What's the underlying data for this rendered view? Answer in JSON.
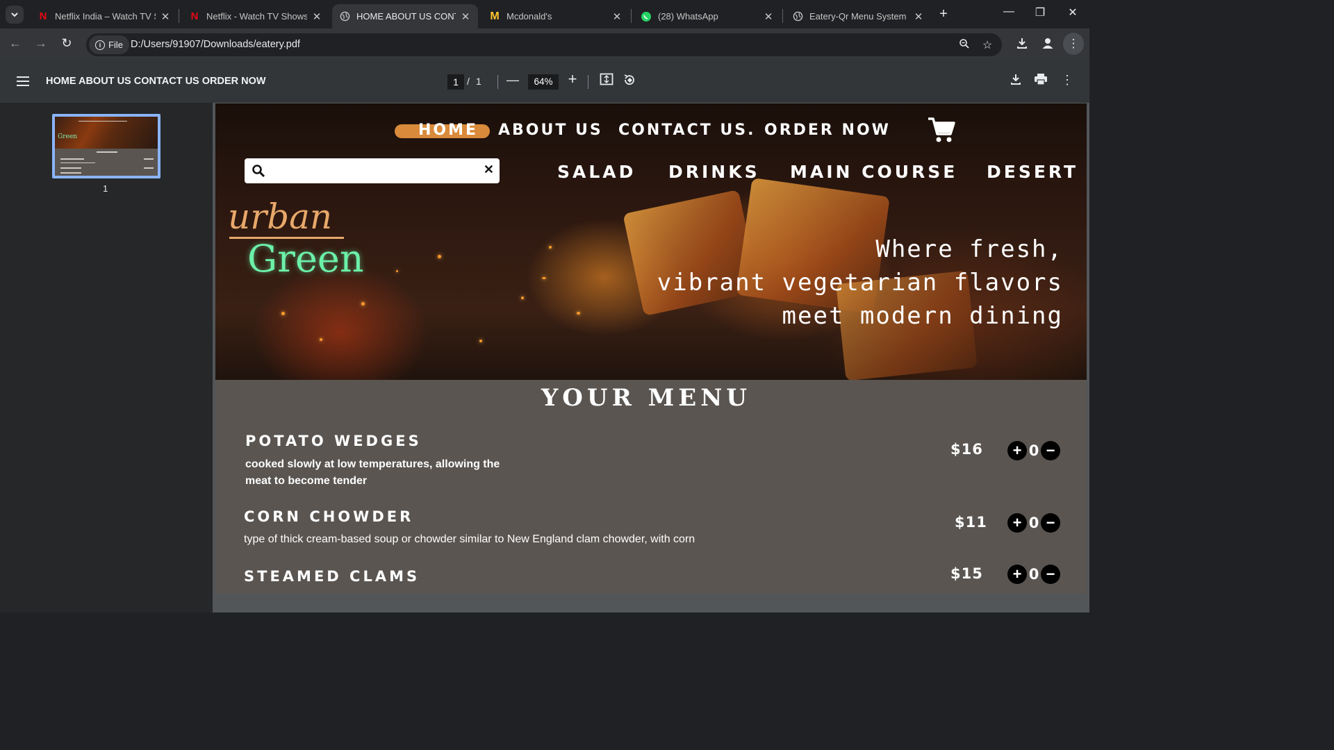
{
  "tabs": [
    {
      "title": "Netflix India – Watch TV Sh",
      "icon": "netflix-icon"
    },
    {
      "title": "Netflix - Watch TV Shows C",
      "icon": "netflix-icon"
    },
    {
      "title": "HOME ABOUT US CONTAC",
      "icon": "globe-icon",
      "active": true
    },
    {
      "title": "Mcdonald's",
      "icon": "mcdonalds-icon"
    },
    {
      "title": "(28) WhatsApp",
      "icon": "whatsapp-icon"
    },
    {
      "title": "Eatery-Qr Menu System",
      "icon": "globe-icon"
    }
  ],
  "address": {
    "chip_label": "File",
    "url": "D:/Users/91907/Downloads/eatery.pdf"
  },
  "pdf_toolbar": {
    "title": "HOME ABOUT US CONTACT US ORDER NOW",
    "current_page": "1",
    "separator": "/",
    "total_pages": "1",
    "zoom": "64%"
  },
  "sidebar": {
    "thumbnail_number": "1"
  },
  "site": {
    "nav": {
      "home": "HOME",
      "about": "ABOUT US",
      "contact": "CONTACT US.",
      "order": "ORDER NOW"
    },
    "search": {
      "value": "",
      "clear": "✕"
    },
    "categories": [
      "SALAD",
      "DRINKS",
      "MAIN COURSE",
      "DESERT"
    ],
    "logo": {
      "top": "urban",
      "bottom": "Green"
    },
    "tagline": [
      "Where fresh,",
      "vibrant vegetarian flavors",
      "meet modern dining"
    ],
    "menu_title": "YOUR MENU",
    "items": [
      {
        "name": "POTATO WEDGES",
        "desc": "cooked slowly at low temperatures, allowing the meat to become tender",
        "price": "$16",
        "qty": "0"
      },
      {
        "name": "CORN CHOWDER",
        "desc": "type of thick cream-based soup or chowder similar to New England clam chowder, with corn",
        "price": "$11",
        "qty": "0"
      },
      {
        "name": "STEAMED CLAMS",
        "desc": "",
        "price": "$15",
        "qty": "0"
      }
    ]
  },
  "colors": {
    "accent_orange": "#d98a3a",
    "logo_green": "#6cf0a8",
    "logo_orange": "#e8a86a",
    "page_bg": "#5a5551",
    "thumb_border": "#8ab4f8"
  }
}
